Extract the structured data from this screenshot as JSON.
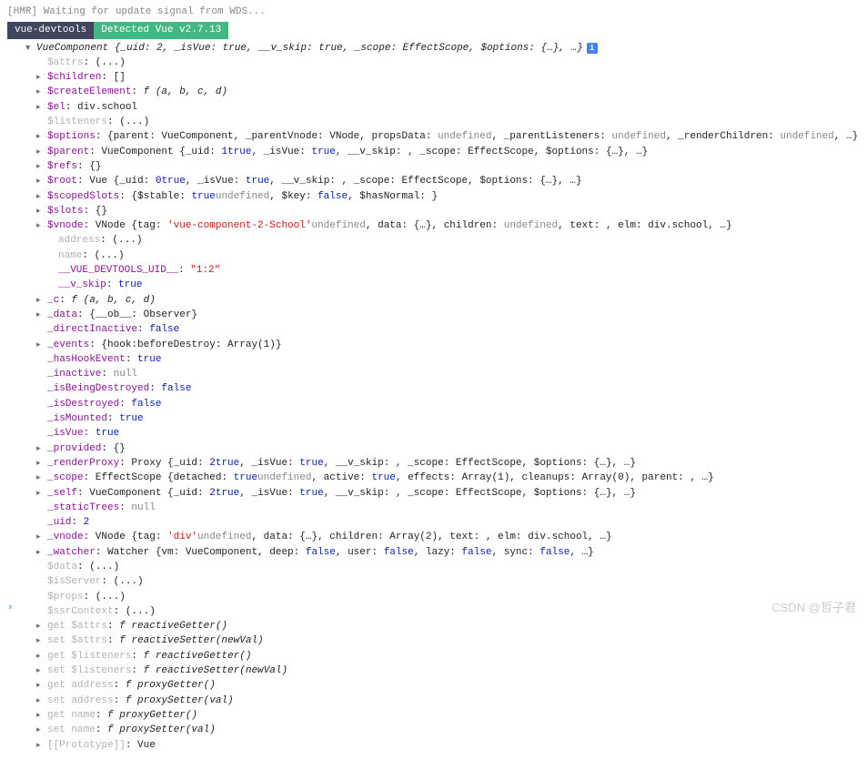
{
  "hmr": "[HMR] Waiting for update signal from WDS...",
  "badge1": "vue-devtools",
  "badge2": "Detected Vue v2.7.13",
  "root": "VueComponent {_uid: 2, _isVue: true, __v_skip: true, _scope: EffectScope, $options: {…}, …}",
  "infoIcon": "i",
  "rows": [
    {
      "indent": 1,
      "tri": "",
      "key": "$attrs",
      "kl": true,
      "val": ": (...)"
    },
    {
      "indent": 1,
      "tri": "r",
      "key": "$children",
      "val": ": []"
    },
    {
      "indent": 1,
      "tri": "r",
      "key": "$createElement",
      "val": ": ",
      "fn": "f (a, b, c, d)"
    },
    {
      "indent": 1,
      "tri": "r",
      "key": "$el",
      "val": ": div.school"
    },
    {
      "indent": 1,
      "tri": "",
      "key": "$listeners",
      "kl": true,
      "val": ": (...)"
    },
    {
      "indent": 1,
      "tri": "r",
      "key": "$options",
      "val": ": {parent: VueComponent, _parentVnode: VNode, propsData: ",
      "u": "undefined",
      "val2": ", _parentListeners: ",
      "u2": "undefined",
      "val3": ", _renderChildren: ",
      "u3": "undefined",
      "val4": ", …}"
    },
    {
      "indent": 1,
      "tri": "r",
      "key": "$parent",
      "val": ": VueComponent {_uid: ",
      "n": "1",
      "val2": ", _isVue: ",
      "b": "true",
      "val3": ", __v_skip: ",
      "b2": "true",
      "val4": ", _scope: EffectScope, $options: {…}, …}"
    },
    {
      "indent": 1,
      "tri": "r",
      "key": "$refs",
      "val": ": {}"
    },
    {
      "indent": 1,
      "tri": "r",
      "key": "$root",
      "val": ": Vue {_uid: ",
      "n": "0",
      "val2": ", _isVue: ",
      "b": "true",
      "val3": ", __v_skip: ",
      "b2": "true",
      "val4": ", _scope: EffectScope, $options: {…}, …}"
    },
    {
      "indent": 1,
      "tri": "r",
      "key": "$scopedSlots",
      "val": ": {$stable: ",
      "b": "true",
      "val2": ", $key: ",
      "u": "undefined",
      "val3": ", $hasNormal: ",
      "b2": "false",
      "val4": "}"
    },
    {
      "indent": 1,
      "tri": "r",
      "key": "$slots",
      "val": ": {}"
    },
    {
      "indent": 1,
      "tri": "r",
      "key": "$vnode",
      "val": ": VNode {tag: ",
      "s": "'vue-component-2-School'",
      "val2": ", data: {…}, children: ",
      "u": "undefined",
      "val3": ", text: ",
      "u2": "undefined",
      "val4": ", elm: div.school, …}"
    },
    {
      "indent": 2,
      "tri": "",
      "key": "address",
      "kl": true,
      "val": ": (...)"
    },
    {
      "indent": 2,
      "tri": "",
      "key": "name",
      "kl": true,
      "val": ": (...)"
    },
    {
      "indent": 2,
      "tri": "",
      "key": "__VUE_DEVTOOLS_UID__",
      "val": ": ",
      "s": "\"1:2\""
    },
    {
      "indent": 2,
      "tri": "",
      "key": "__v_skip",
      "val": ": ",
      "b": "true"
    },
    {
      "indent": 1,
      "tri": "r",
      "key": "_c",
      "val": ": ",
      "fn": "f (a, b, c, d)"
    },
    {
      "indent": 1,
      "tri": "r",
      "key": "_data",
      "val": ": {__ob__: Observer}"
    },
    {
      "indent": 1,
      "tri": "",
      "key": "_directInactive",
      "val": ": ",
      "b": "false"
    },
    {
      "indent": 1,
      "tri": "r",
      "key": "_events",
      "val": ": {hook:beforeDestroy: Array(1)}"
    },
    {
      "indent": 1,
      "tri": "",
      "key": "_hasHookEvent",
      "val": ": ",
      "b": "true"
    },
    {
      "indent": 1,
      "tri": "",
      "key": "_inactive",
      "val": ": ",
      "u": "null"
    },
    {
      "indent": 1,
      "tri": "",
      "key": "_isBeingDestroyed",
      "val": ": ",
      "b": "false"
    },
    {
      "indent": 1,
      "tri": "",
      "key": "_isDestroyed",
      "val": ": ",
      "b": "false"
    },
    {
      "indent": 1,
      "tri": "",
      "key": "_isMounted",
      "val": ": ",
      "b": "true"
    },
    {
      "indent": 1,
      "tri": "",
      "key": "_isVue",
      "val": ": ",
      "b": "true"
    },
    {
      "indent": 1,
      "tri": "r",
      "key": "_provided",
      "val": ": {}"
    },
    {
      "indent": 1,
      "tri": "r",
      "key": "_renderProxy",
      "val": ": Proxy {_uid: ",
      "n": "2",
      "val2": ", _isVue: ",
      "b": "true",
      "val3": ", __v_skip: ",
      "b2": "true",
      "val4": ", _scope: EffectScope, $options: {…}, …}"
    },
    {
      "indent": 1,
      "tri": "r",
      "key": "_scope",
      "val": ": EffectScope {detached: ",
      "b": "true",
      "val2": ", active: ",
      "b2": "true",
      "val3": ", effects: Array(1), cleanups: Array(0), parent: ",
      "u": "undefined",
      "val4": ", …}"
    },
    {
      "indent": 1,
      "tri": "r",
      "key": "_self",
      "val": ": VueComponent {_uid: ",
      "n": "2",
      "val2": ", _isVue: ",
      "b": "true",
      "val3": ", __v_skip: ",
      "b2": "true",
      "val4": ", _scope: EffectScope, $options: {…}, …}"
    },
    {
      "indent": 1,
      "tri": "",
      "key": "_staticTrees",
      "val": ": ",
      "u": "null"
    },
    {
      "indent": 1,
      "tri": "",
      "key": "_uid",
      "val": ": ",
      "n": "2"
    },
    {
      "indent": 1,
      "tri": "r",
      "key": "_vnode",
      "val": ": VNode {tag: ",
      "s": "'div'",
      "val2": ", data: {…}, children: Array(2), text: ",
      "u": "undefined",
      "val3": ", elm: div.school, …}"
    },
    {
      "indent": 1,
      "tri": "r",
      "key": "_watcher",
      "val": ": Watcher {vm: VueComponent, deep: ",
      "b": "false",
      "val2": ", user: ",
      "b2": "false",
      "val3": ", lazy: ",
      "b3": "false",
      "val4": ", sync: ",
      "b4": "false",
      "val5": ", …}"
    },
    {
      "indent": 1,
      "tri": "",
      "key": "$data",
      "kl": true,
      "val": ": (...)"
    },
    {
      "indent": 1,
      "tri": "",
      "key": "$isServer",
      "kl": true,
      "val": ": (...)"
    },
    {
      "indent": 1,
      "tri": "",
      "key": "$props",
      "kl": true,
      "val": ": (...)"
    },
    {
      "indent": 1,
      "tri": "",
      "key": "$ssrContext",
      "kl": true,
      "val": ": (...)"
    },
    {
      "indent": 1,
      "tri": "r",
      "key": "get $attrs",
      "kl": true,
      "val": ": ",
      "fn": "f reactiveGetter()"
    },
    {
      "indent": 1,
      "tri": "r",
      "key": "set $attrs",
      "kl": true,
      "val": ": ",
      "fn": "f reactiveSetter(newVal)"
    },
    {
      "indent": 1,
      "tri": "r",
      "key": "get $listeners",
      "kl": true,
      "val": ": ",
      "fn": "f reactiveGetter()"
    },
    {
      "indent": 1,
      "tri": "r",
      "key": "set $listeners",
      "kl": true,
      "val": ": ",
      "fn": "f reactiveSetter(newVal)"
    },
    {
      "indent": 1,
      "tri": "r",
      "key": "get address",
      "kl": true,
      "val": ": ",
      "fn": "f proxyGetter()"
    },
    {
      "indent": 1,
      "tri": "r",
      "key": "set address",
      "kl": true,
      "val": ": ",
      "fn": "f proxySetter(val)"
    },
    {
      "indent": 1,
      "tri": "r",
      "key": "get name",
      "kl": true,
      "val": ": ",
      "fn": "f proxyGetter()"
    },
    {
      "indent": 1,
      "tri": "r",
      "key": "set name",
      "kl": true,
      "val": ": ",
      "fn": "f proxySetter(val)"
    },
    {
      "indent": 1,
      "tri": "r",
      "key": "[[Prototype]]",
      "kl": true,
      "val": ": Vue"
    }
  ],
  "prompt": "›",
  "watermark": "CSDN @哲子君"
}
